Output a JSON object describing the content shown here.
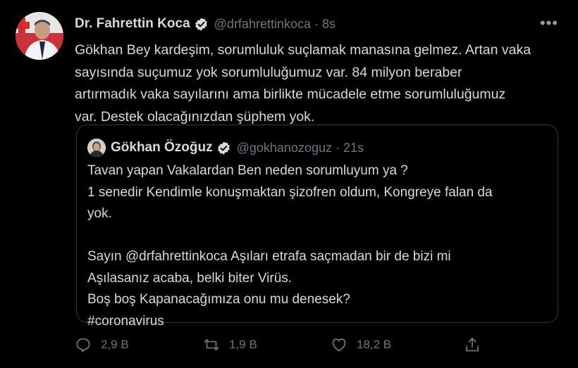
{
  "tweet": {
    "author_name": "Dr. Fahrettin Koca",
    "handle": "@drfahrettinkoca",
    "separator": "·",
    "time": "8s",
    "more_label": "•••",
    "text": "Gökhan Bey kardeşim, sorumluluk suçlamak manasına gelmez. Artan vaka\nsayısında suçumuz yok sorumluluğumuz var. 84 milyon beraber\nartırmadık vaka sayılarını ama birlikte mücadele etme sorumluluğumuz\nvar. Destek olacağınızdan şüphem yok."
  },
  "quoted": {
    "author_name": "Gökhan Özoğuz",
    "handle": "@gokhanozoguz",
    "separator": "·",
    "time": "21s",
    "text": "Tavan yapan Vakalardan Ben neden sorumluyum ya ?\n1 senedir Kendimle konuşmaktan şizofren oldum, Kongreye falan da\nyok.\n\nSayın @drfahrettinkoca Aşıları etrafa saçmadan bir de bizi mi\nAşılasanız acaba, belki biter Virüs.\nBoş boş Kapanacağımıza onu mu denesek?\n#coronavirus"
  },
  "actions": {
    "reply_count": "2,9 B",
    "retweet_count": "1,9 B",
    "like_count": "18,2 B",
    "share_label": ""
  },
  "colors": {
    "background": "#000000",
    "text": "#d9d9d9",
    "muted": "#6e767d",
    "border": "#333639"
  },
  "icons": [
    "verified-badge-icon",
    "more-icon",
    "reply-icon",
    "retweet-icon",
    "like-icon",
    "share-icon"
  ]
}
